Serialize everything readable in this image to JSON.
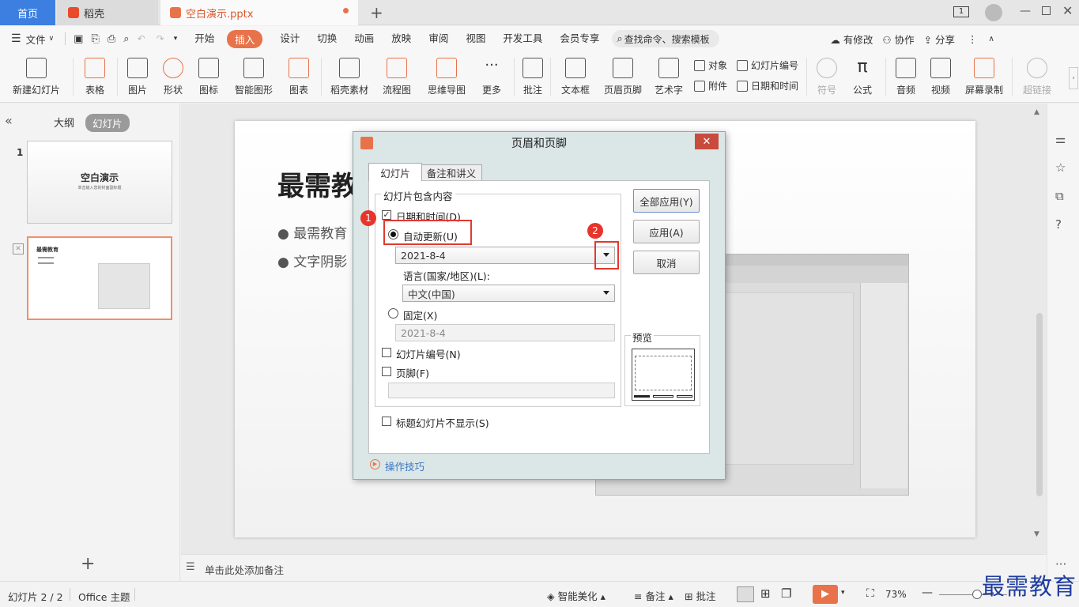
{
  "tabs": {
    "home": "首页",
    "wps": "稻壳",
    "file": "空白演示.pptx"
  },
  "menu": {
    "file": "文件",
    "items": [
      "开始",
      "插入",
      "设计",
      "切换",
      "动画",
      "放映",
      "审阅",
      "视图",
      "开发工具",
      "会员专享"
    ],
    "active_index": 1,
    "search": "查找命令、搜索模板",
    "has_changes": "有修改",
    "collab": "协作",
    "share": "分享"
  },
  "ribbon": {
    "new_slide": "新建幻灯片",
    "table": "表格",
    "picture": "图片",
    "shape": "形状",
    "icon": "图标",
    "smartart": "智能图形",
    "chart": "图表",
    "docer": "稻壳素材",
    "flow": "流程图",
    "mind": "思维导图",
    "more": "更多",
    "comment": "批注",
    "textbox": "文本框",
    "header_footer": "页眉页脚",
    "wordart": "艺术字",
    "object": "对象",
    "slide_number": "幻灯片编号",
    "attachment": "附件",
    "datetime": "日期和时间",
    "symbol": "符号",
    "formula": "公式",
    "audio": "音频",
    "video": "视频",
    "screen_rec": "屏幕录制",
    "hyperlink": "超链接"
  },
  "left": {
    "outline": "大纲",
    "slides": "幻灯片",
    "thumb1_num": "1",
    "thumb1_title": "空白演示",
    "thumb1_sub": "单击输入您的封面副标题",
    "thumb2_title": "最需教育"
  },
  "slide": {
    "title": "最需教",
    "bullet1": "最需教育",
    "bullet2": "文字阴影"
  },
  "notes": "单击此处添加备注",
  "dialog": {
    "title": "页眉和页脚",
    "tab_slide": "幻灯片",
    "tab_notes": "备注和讲义",
    "group": "幻灯片包含内容",
    "datetime": "日期和时间(D)",
    "auto_update": "自动更新(U)",
    "date_value": "2021-8-4",
    "language_label": "语言(国家/地区)(L):",
    "language_value": "中文(中国)",
    "fixed": "固定(X)",
    "fixed_value": "2021-8-4",
    "slide_number": "幻灯片编号(N)",
    "footer": "页脚(F)",
    "hide_title": "标题幻灯片不显示(S)",
    "apply_all": "全部应用(Y)",
    "apply": "应用(A)",
    "cancel": "取消",
    "preview": "预览",
    "tips": "操作技巧",
    "badge1": "1",
    "badge2": "2"
  },
  "status": {
    "slide_info": "幻灯片 2 / 2",
    "theme": "Office 主题",
    "beautify": "智能美化",
    "notes": "备注",
    "comment": "批注",
    "zoom": "73%"
  },
  "watermark": "最需教育",
  "colors": {
    "accent": "#e8734a",
    "home_tab": "#3c7fe0",
    "highlight": "#e03a2e",
    "play": "#e8734a"
  }
}
